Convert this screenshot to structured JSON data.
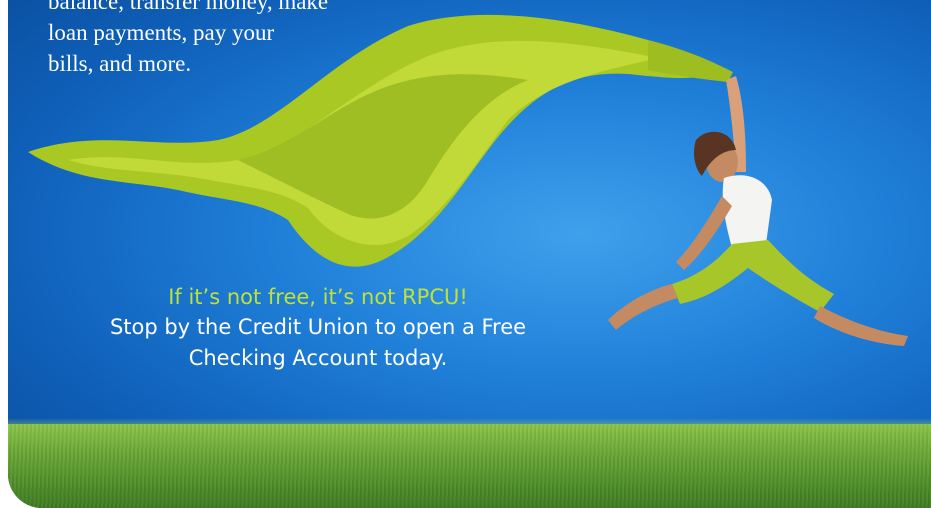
{
  "intro": {
    "lines": [
      "balance, transfer money, make",
      "loan payments, pay your",
      "bills, and more."
    ]
  },
  "cta": {
    "slogan": "If it’s not free, it’s not RPCU!",
    "line1": "Stop by the Credit Union to open a Free",
    "line2": "Checking Account today."
  },
  "colors": {
    "sky": "#1f7fd8",
    "scarf": "#b6d22a",
    "grass": "#5b9a2e",
    "slogan": "#bfe23a",
    "text": "#ffffff"
  }
}
